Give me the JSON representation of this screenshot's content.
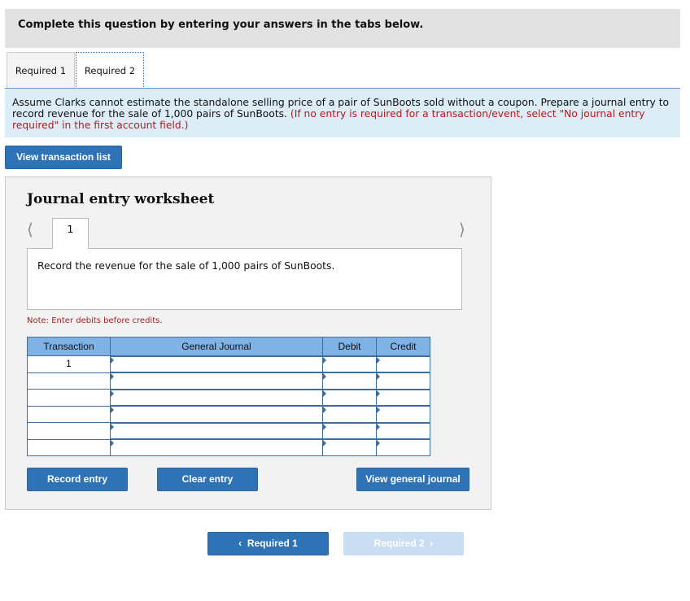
{
  "header": {
    "title": "Complete this question by entering your answers in the tabs below."
  },
  "tabs": [
    {
      "label": "Required 1"
    },
    {
      "label": "Required 2"
    }
  ],
  "instructions": {
    "text": "Assume Clarks cannot estimate the standalone selling price of a pair of SunBoots sold without a coupon. Prepare a journal entry to record revenue for the sale of 1,000 pairs of SunBoots.",
    "note": "(If no entry is required for a transaction/event, select \"No journal entry required\" in the first account field.)"
  },
  "buttons": {
    "view_transaction_list": "View transaction list",
    "record_entry": "Record entry",
    "clear_entry": "Clear entry",
    "view_general_journal": "View general journal",
    "prev_required": "Required 1",
    "next_required": "Required 2"
  },
  "worksheet": {
    "title": "Journal entry worksheet",
    "current_tab": "1",
    "description": "Record the revenue for the sale of 1,000 pairs of SunBoots.",
    "note": "Note: Enter debits before credits.",
    "columns": [
      "Transaction",
      "General Journal",
      "Debit",
      "Credit"
    ],
    "rows": [
      {
        "transaction": "1",
        "account": "",
        "debit": "",
        "credit": ""
      },
      {
        "transaction": "",
        "account": "",
        "debit": "",
        "credit": ""
      },
      {
        "transaction": "",
        "account": "",
        "debit": "",
        "credit": ""
      },
      {
        "transaction": "",
        "account": "",
        "debit": "",
        "credit": ""
      },
      {
        "transaction": "",
        "account": "",
        "debit": "",
        "credit": ""
      },
      {
        "transaction": "",
        "account": "",
        "debit": "",
        "credit": ""
      }
    ]
  },
  "icons": {
    "prev": "chevron-left-icon",
    "next": "chevron-right-icon"
  }
}
